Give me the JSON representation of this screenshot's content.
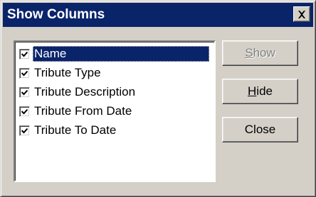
{
  "window": {
    "title": "Show Columns",
    "close_icon": "close-icon"
  },
  "columns_list": {
    "items": [
      {
        "label": "Name",
        "checked": true,
        "selected": true
      },
      {
        "label": "Tribute Type",
        "checked": true,
        "selected": false
      },
      {
        "label": "Tribute Description",
        "checked": true,
        "selected": false
      },
      {
        "label": "Tribute From Date",
        "checked": true,
        "selected": false
      },
      {
        "label": "Tribute To Date",
        "checked": true,
        "selected": false
      }
    ]
  },
  "buttons": {
    "show": {
      "mnemonic": "S",
      "rest": "how",
      "enabled": false
    },
    "hide": {
      "mnemonic": "H",
      "rest": "ide",
      "enabled": true
    },
    "close": {
      "label": "Close",
      "enabled": true
    }
  },
  "colors": {
    "face": "#d4d0c8",
    "titlebar": "#0a246a",
    "selection": "#0a246a"
  }
}
